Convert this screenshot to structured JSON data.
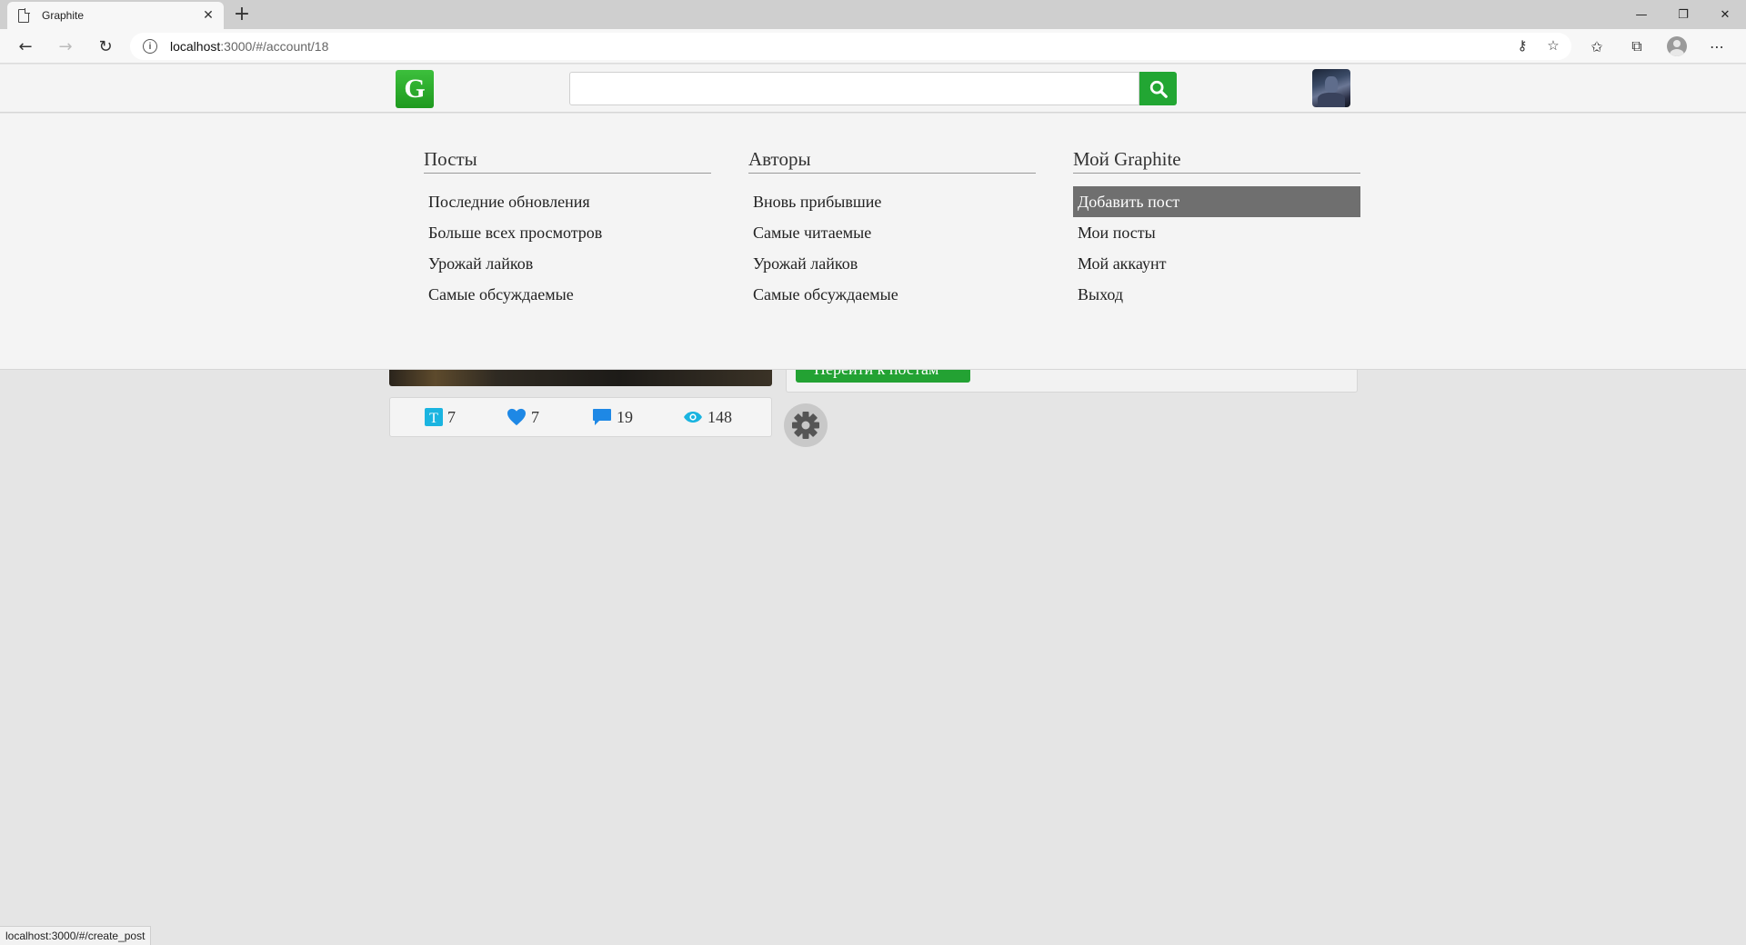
{
  "browser": {
    "tab_title": "Graphite",
    "tab_close": "✕",
    "new_tab": "+",
    "url_host": "localhost",
    "url_path": ":3000/#/account/18",
    "status_url": "localhost:3000/#/create_post",
    "controls": {
      "minimize": "—",
      "restore": "❐",
      "close": "✕"
    },
    "icons": [
      "page-icon",
      "back-arrow-icon",
      "forward-arrow-icon",
      "refresh-icon",
      "info-icon",
      "key-icon",
      "star-add-icon",
      "favorites-icon",
      "collections-icon",
      "profile-icon",
      "more-icon"
    ]
  },
  "header": {
    "logo_letter": "G",
    "search_placeholder": "",
    "accent_color": "#22a633"
  },
  "menu": {
    "columns": [
      {
        "title": "Посты",
        "items": [
          "Последние обновления",
          "Больше всех просмотров",
          "Урожай лайков",
          "Самые обсуждаемые"
        ]
      },
      {
        "title": "Авторы",
        "items": [
          "Вновь прибывшие",
          "Самые читаемые",
          "Урожай лайков",
          "Самые обсуждаемые"
        ]
      },
      {
        "title": "Мой Graphite",
        "items": [
          "Добавить пост",
          "Мои посты",
          "Мой аккаунт",
          "Выход"
        ],
        "active_index": 0
      }
    ]
  },
  "content": {
    "goto_button": "Перейти к постам",
    "stats": {
      "posts": "7",
      "likes": "7",
      "comments": "19",
      "views": "148"
    },
    "stat_colors": {
      "posts": "#1ab4e0",
      "likes": "#1e88e5",
      "comments": "#1e88e5",
      "views": "#1ab4e0"
    }
  }
}
